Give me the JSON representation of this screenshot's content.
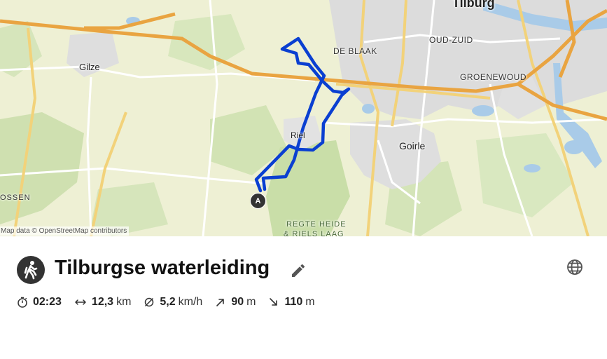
{
  "map": {
    "attribution": "Map data © OpenStreetMap contributors",
    "labels": {
      "tilburg": "Tilburg",
      "oud_zuid": "OUD-ZUID",
      "de_blaak": "DE BLAAK",
      "groenewoud": "GROENEWOUD",
      "gilze": "Gilze",
      "riel": "Riel",
      "goirle": "Goirle",
      "ossen": "OSSEN",
      "regte_heide_1": "REGTE HEIDE",
      "regte_heide_2": "& RIELS LAAG"
    },
    "start_marker": "A",
    "route_color": "#0a3fd1"
  },
  "route": {
    "title": "Tilburgse waterleiding",
    "activity_icon": "hiking-icon",
    "stats": {
      "duration": "02:23",
      "distance": "12,3",
      "distance_unit": "km",
      "speed": "5,2",
      "speed_unit": "km/h",
      "ascent": "90",
      "ascent_unit": "m",
      "descent": "110",
      "descent_unit": "m"
    }
  }
}
